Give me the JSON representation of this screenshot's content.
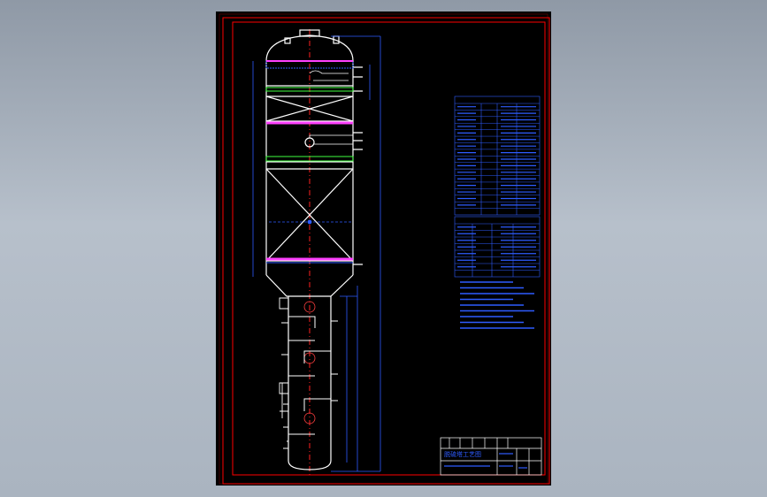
{
  "colors": {
    "background": "#a3adb9",
    "sheet": "#000000",
    "frame_border": "#ff0000",
    "vessel_outline": "#ffffff",
    "annotation": "#2e5cff",
    "centerline": "#ff2020",
    "packing_layer": "#ff40ff",
    "support_grid": "#40ff40",
    "title_block": "#ffffff"
  },
  "title_block": {
    "drawing_title": "脱硫塔工艺图"
  },
  "tables": {
    "design_data_rows": 17,
    "nozzle_table_rows": 8,
    "notes_lines": 9
  },
  "icons": [
    "vessel-icon",
    "manhole-icon",
    "nozzle-icon",
    "packing-bed-icon"
  ]
}
